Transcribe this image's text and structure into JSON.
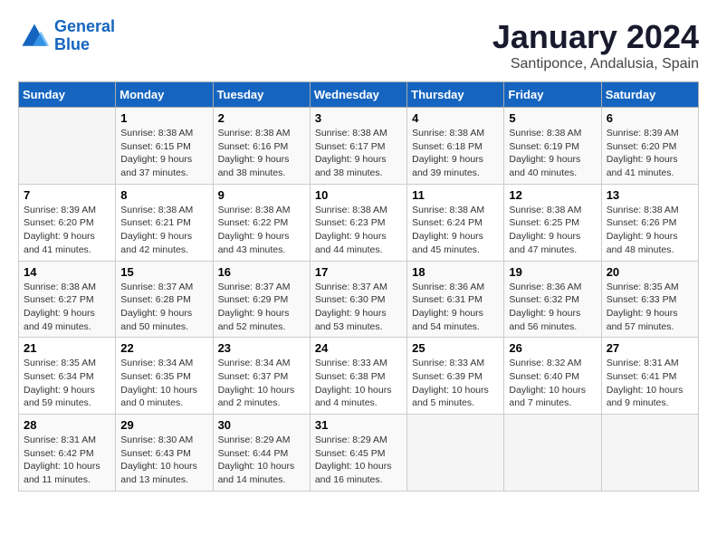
{
  "header": {
    "logo_line1": "General",
    "logo_line2": "Blue",
    "month_title": "January 2024",
    "location": "Santiponce, Andalusia, Spain"
  },
  "weekdays": [
    "Sunday",
    "Monday",
    "Tuesday",
    "Wednesday",
    "Thursday",
    "Friday",
    "Saturday"
  ],
  "weeks": [
    [
      {
        "day": "",
        "info": ""
      },
      {
        "day": "1",
        "info": "Sunrise: 8:38 AM\nSunset: 6:15 PM\nDaylight: 9 hours\nand 37 minutes."
      },
      {
        "day": "2",
        "info": "Sunrise: 8:38 AM\nSunset: 6:16 PM\nDaylight: 9 hours\nand 38 minutes."
      },
      {
        "day": "3",
        "info": "Sunrise: 8:38 AM\nSunset: 6:17 PM\nDaylight: 9 hours\nand 38 minutes."
      },
      {
        "day": "4",
        "info": "Sunrise: 8:38 AM\nSunset: 6:18 PM\nDaylight: 9 hours\nand 39 minutes."
      },
      {
        "day": "5",
        "info": "Sunrise: 8:38 AM\nSunset: 6:19 PM\nDaylight: 9 hours\nand 40 minutes."
      },
      {
        "day": "6",
        "info": "Sunrise: 8:39 AM\nSunset: 6:20 PM\nDaylight: 9 hours\nand 41 minutes."
      }
    ],
    [
      {
        "day": "7",
        "info": "Sunrise: 8:39 AM\nSunset: 6:20 PM\nDaylight: 9 hours\nand 41 minutes."
      },
      {
        "day": "8",
        "info": "Sunrise: 8:38 AM\nSunset: 6:21 PM\nDaylight: 9 hours\nand 42 minutes."
      },
      {
        "day": "9",
        "info": "Sunrise: 8:38 AM\nSunset: 6:22 PM\nDaylight: 9 hours\nand 43 minutes."
      },
      {
        "day": "10",
        "info": "Sunrise: 8:38 AM\nSunset: 6:23 PM\nDaylight: 9 hours\nand 44 minutes."
      },
      {
        "day": "11",
        "info": "Sunrise: 8:38 AM\nSunset: 6:24 PM\nDaylight: 9 hours\nand 45 minutes."
      },
      {
        "day": "12",
        "info": "Sunrise: 8:38 AM\nSunset: 6:25 PM\nDaylight: 9 hours\nand 47 minutes."
      },
      {
        "day": "13",
        "info": "Sunrise: 8:38 AM\nSunset: 6:26 PM\nDaylight: 9 hours\nand 48 minutes."
      }
    ],
    [
      {
        "day": "14",
        "info": "Sunrise: 8:38 AM\nSunset: 6:27 PM\nDaylight: 9 hours\nand 49 minutes."
      },
      {
        "day": "15",
        "info": "Sunrise: 8:37 AM\nSunset: 6:28 PM\nDaylight: 9 hours\nand 50 minutes."
      },
      {
        "day": "16",
        "info": "Sunrise: 8:37 AM\nSunset: 6:29 PM\nDaylight: 9 hours\nand 52 minutes."
      },
      {
        "day": "17",
        "info": "Sunrise: 8:37 AM\nSunset: 6:30 PM\nDaylight: 9 hours\nand 53 minutes."
      },
      {
        "day": "18",
        "info": "Sunrise: 8:36 AM\nSunset: 6:31 PM\nDaylight: 9 hours\nand 54 minutes."
      },
      {
        "day": "19",
        "info": "Sunrise: 8:36 AM\nSunset: 6:32 PM\nDaylight: 9 hours\nand 56 minutes."
      },
      {
        "day": "20",
        "info": "Sunrise: 8:35 AM\nSunset: 6:33 PM\nDaylight: 9 hours\nand 57 minutes."
      }
    ],
    [
      {
        "day": "21",
        "info": "Sunrise: 8:35 AM\nSunset: 6:34 PM\nDaylight: 9 hours\nand 59 minutes."
      },
      {
        "day": "22",
        "info": "Sunrise: 8:34 AM\nSunset: 6:35 PM\nDaylight: 10 hours\nand 0 minutes."
      },
      {
        "day": "23",
        "info": "Sunrise: 8:34 AM\nSunset: 6:37 PM\nDaylight: 10 hours\nand 2 minutes."
      },
      {
        "day": "24",
        "info": "Sunrise: 8:33 AM\nSunset: 6:38 PM\nDaylight: 10 hours\nand 4 minutes."
      },
      {
        "day": "25",
        "info": "Sunrise: 8:33 AM\nSunset: 6:39 PM\nDaylight: 10 hours\nand 5 minutes."
      },
      {
        "day": "26",
        "info": "Sunrise: 8:32 AM\nSunset: 6:40 PM\nDaylight: 10 hours\nand 7 minutes."
      },
      {
        "day": "27",
        "info": "Sunrise: 8:31 AM\nSunset: 6:41 PM\nDaylight: 10 hours\nand 9 minutes."
      }
    ],
    [
      {
        "day": "28",
        "info": "Sunrise: 8:31 AM\nSunset: 6:42 PM\nDaylight: 10 hours\nand 11 minutes."
      },
      {
        "day": "29",
        "info": "Sunrise: 8:30 AM\nSunset: 6:43 PM\nDaylight: 10 hours\nand 13 minutes."
      },
      {
        "day": "30",
        "info": "Sunrise: 8:29 AM\nSunset: 6:44 PM\nDaylight: 10 hours\nand 14 minutes."
      },
      {
        "day": "31",
        "info": "Sunrise: 8:29 AM\nSunset: 6:45 PM\nDaylight: 10 hours\nand 16 minutes."
      },
      {
        "day": "",
        "info": ""
      },
      {
        "day": "",
        "info": ""
      },
      {
        "day": "",
        "info": ""
      }
    ]
  ]
}
